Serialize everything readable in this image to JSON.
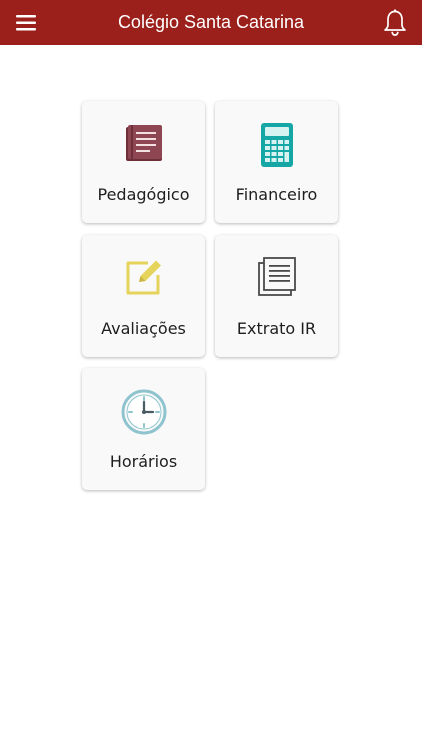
{
  "header": {
    "title": "Colégio Santa Catarina",
    "background_color": "#9b1f1a",
    "menu_icon": "hamburger-menu-icon",
    "notification_icon": "bell-icon"
  },
  "menu": {
    "items": [
      {
        "label": "Pedagógico",
        "icon": "book-icon",
        "color": "#8e4653"
      },
      {
        "label": "Financeiro",
        "icon": "calculator-icon",
        "color": "#14a7a5"
      },
      {
        "label": "Avaliações",
        "icon": "edit-pencil-icon",
        "color": "#e6d35c"
      },
      {
        "label": "Extrato IR",
        "icon": "document-list-icon",
        "color": "#4a4a4a"
      },
      {
        "label": "Horários",
        "icon": "clock-icon",
        "color": "#8fc4cf"
      }
    ]
  }
}
